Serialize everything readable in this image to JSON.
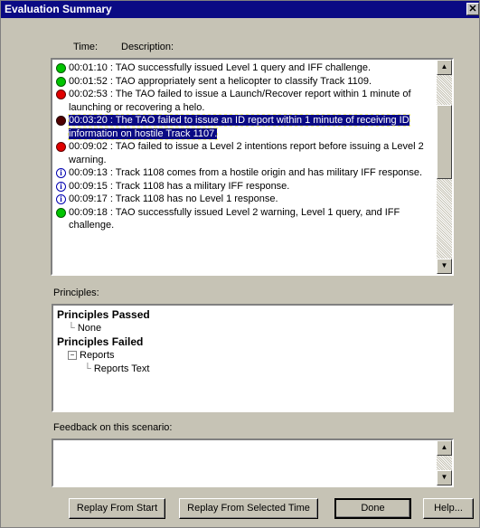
{
  "window": {
    "title": "Evaluation Summary",
    "close_label": "✕"
  },
  "columns": {
    "time": "Time:",
    "description": "Description:"
  },
  "events": [
    {
      "icon": "green-circle-icon",
      "status": "green",
      "text": "00:01:10 : TAO successfully issued Level 1 query and IFF challenge."
    },
    {
      "icon": "green-circle-icon",
      "status": "green",
      "text": "00:01:52 : TAO appropriately sent a helicopter to classify Track 1109."
    },
    {
      "icon": "red-circle-icon",
      "status": "red",
      "text": "00:02:53 : The TAO failed to issue a Launch/Recover report within 1 minute of launching or recovering a helo."
    },
    {
      "icon": "dark-red-circle-icon",
      "status": "darkred",
      "selected": true,
      "text": "00:03:20 : The TAO failed to issue an ID report within 1 minute of receiving ID information on hostile Track 1107."
    },
    {
      "icon": "red-circle-icon",
      "status": "red",
      "text": "00:09:02 : TAO failed to issue a Level 2 intentions report before issuing a Level 2 warning."
    },
    {
      "icon": "info-icon",
      "status": "info",
      "text": "00:09:13 : Track 1108 comes from a hostile origin and has military IFF response."
    },
    {
      "icon": "info-icon",
      "status": "info",
      "text": "00:09:15 : Track 1108 has a military IFF response."
    },
    {
      "icon": "info-icon",
      "status": "info",
      "text": "00:09:17 : Track 1108 has no Level 1 response."
    },
    {
      "icon": "green-circle-icon",
      "status": "green",
      "text": "00:09:18 : TAO successfully issued Level 2 warning, Level 1 query, and IFF challenge."
    }
  ],
  "principles": {
    "label": "Principles:",
    "passed_header": "Principles Passed",
    "passed_items": [
      "None"
    ],
    "failed_header": "Principles Failed",
    "failed_group": "Reports",
    "failed_group_sign": "−",
    "failed_items": [
      "Reports Text"
    ],
    "tree_branch": "└"
  },
  "feedback": {
    "label": "Feedback on this scenario:",
    "value": ""
  },
  "buttons": {
    "replay_start": "Replay From Start",
    "replay_selected": "Replay From Selected Time",
    "done": "Done",
    "help": "Help..."
  },
  "scroll_glyphs": {
    "up": "▲",
    "down": "▼"
  }
}
